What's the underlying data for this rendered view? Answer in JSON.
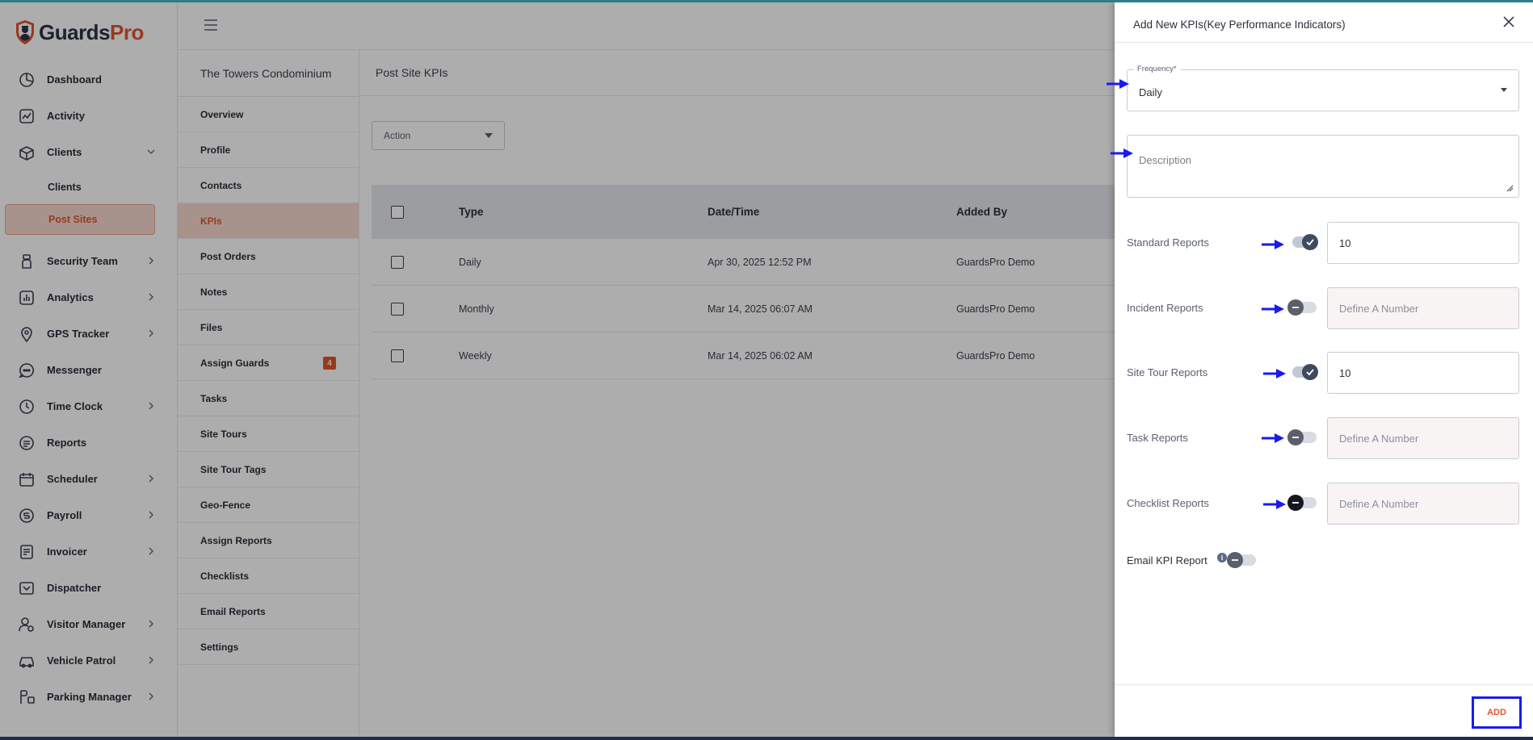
{
  "brand": {
    "name_part1": "Guards",
    "name_part2": "Pro"
  },
  "sidebar": {
    "items": [
      {
        "label": "Dashboard",
        "icon": "dashboard-icon",
        "chevron": false
      },
      {
        "label": "Activity",
        "icon": "activity-icon",
        "chevron": false
      },
      {
        "label": "Clients",
        "icon": "clients-icon",
        "chevron": "down"
      }
    ],
    "subitems": [
      {
        "label": "Clients",
        "active": false
      },
      {
        "label": "Post Sites",
        "active": true
      }
    ],
    "items2": [
      {
        "label": "Security Team",
        "icon": "security-team-icon",
        "chevron": true
      },
      {
        "label": "Analytics",
        "icon": "analytics-icon",
        "chevron": true
      },
      {
        "label": "GPS Tracker",
        "icon": "gps-icon",
        "chevron": true
      },
      {
        "label": "Messenger",
        "icon": "messenger-icon",
        "chevron": false
      },
      {
        "label": "Time Clock",
        "icon": "clock-icon",
        "chevron": true
      },
      {
        "label": "Reports",
        "icon": "reports-icon",
        "chevron": false
      },
      {
        "label": "Scheduler",
        "icon": "calendar-icon",
        "chevron": true
      },
      {
        "label": "Payroll",
        "icon": "payroll-icon",
        "chevron": true
      },
      {
        "label": "Invoicer",
        "icon": "invoice-icon",
        "chevron": true
      },
      {
        "label": "Dispatcher",
        "icon": "dispatcher-icon",
        "chevron": false
      },
      {
        "label": "Visitor Manager",
        "icon": "visitor-icon",
        "chevron": true
      },
      {
        "label": "Vehicle Patrol",
        "icon": "car-icon",
        "chevron": true
      },
      {
        "label": "Parking Manager",
        "icon": "parking-icon",
        "chevron": true
      }
    ]
  },
  "site_menu": {
    "title": "The Towers Condominium",
    "items": [
      {
        "label": "Overview",
        "active": false,
        "badge": ""
      },
      {
        "label": "Profile",
        "active": false,
        "badge": ""
      },
      {
        "label": "Contacts",
        "active": false,
        "badge": ""
      },
      {
        "label": "KPIs",
        "active": true,
        "badge": ""
      },
      {
        "label": "Post Orders",
        "active": false,
        "badge": ""
      },
      {
        "label": "Notes",
        "active": false,
        "badge": ""
      },
      {
        "label": "Files",
        "active": false,
        "badge": ""
      },
      {
        "label": "Assign Guards",
        "active": false,
        "badge": "4"
      },
      {
        "label": "Tasks",
        "active": false,
        "badge": ""
      },
      {
        "label": "Site Tours",
        "active": false,
        "badge": ""
      },
      {
        "label": "Site Tour Tags",
        "active": false,
        "badge": ""
      },
      {
        "label": "Geo-Fence",
        "active": false,
        "badge": ""
      },
      {
        "label": "Assign Reports",
        "active": false,
        "badge": ""
      },
      {
        "label": "Checklists",
        "active": false,
        "badge": ""
      },
      {
        "label": "Email Reports",
        "active": false,
        "badge": ""
      },
      {
        "label": "Settings",
        "active": false,
        "badge": ""
      }
    ]
  },
  "main": {
    "title": "Post Site KPIs",
    "action_label": "Action",
    "table": {
      "headers": {
        "type": "Type",
        "datetime": "Date/Time",
        "added_by": "Added By"
      },
      "rows": [
        {
          "type": "Daily",
          "datetime": "Apr 30, 2025 12:52 PM",
          "added_by": "GuardsPro Demo"
        },
        {
          "type": "Monthly",
          "datetime": "Mar 14, 2025 06:07 AM",
          "added_by": "GuardsPro Demo"
        },
        {
          "type": "Weekly",
          "datetime": "Mar 14, 2025 06:02 AM",
          "added_by": "GuardsPro Demo"
        }
      ]
    }
  },
  "drawer": {
    "title": "Add New KPIs(Key Performance Indicators)",
    "frequency": {
      "label": "Frequency*",
      "value": "Daily"
    },
    "description": {
      "placeholder": "Description"
    },
    "kpis": [
      {
        "label": "Standard Reports",
        "enabled": true,
        "value": "10",
        "placeholder": "Define A Number"
      },
      {
        "label": "Incident Reports",
        "enabled": false,
        "value": "",
        "placeholder": "Define A Number"
      },
      {
        "label": "Site Tour Reports",
        "enabled": true,
        "value": "10",
        "placeholder": "Define A Number"
      },
      {
        "label": "Task Reports",
        "enabled": false,
        "value": "",
        "placeholder": "Define A Number"
      },
      {
        "label": "Checklist Reports",
        "enabled": false,
        "value": "",
        "placeholder": "Define A Number"
      }
    ],
    "email_kpi": {
      "label": "Email KPI Report",
      "info": "i",
      "enabled": false
    },
    "add_label": "ADD"
  },
  "colors": {
    "accent": "#e0552d",
    "annotation": "#1a1aee",
    "teal": "#2d7f86"
  }
}
